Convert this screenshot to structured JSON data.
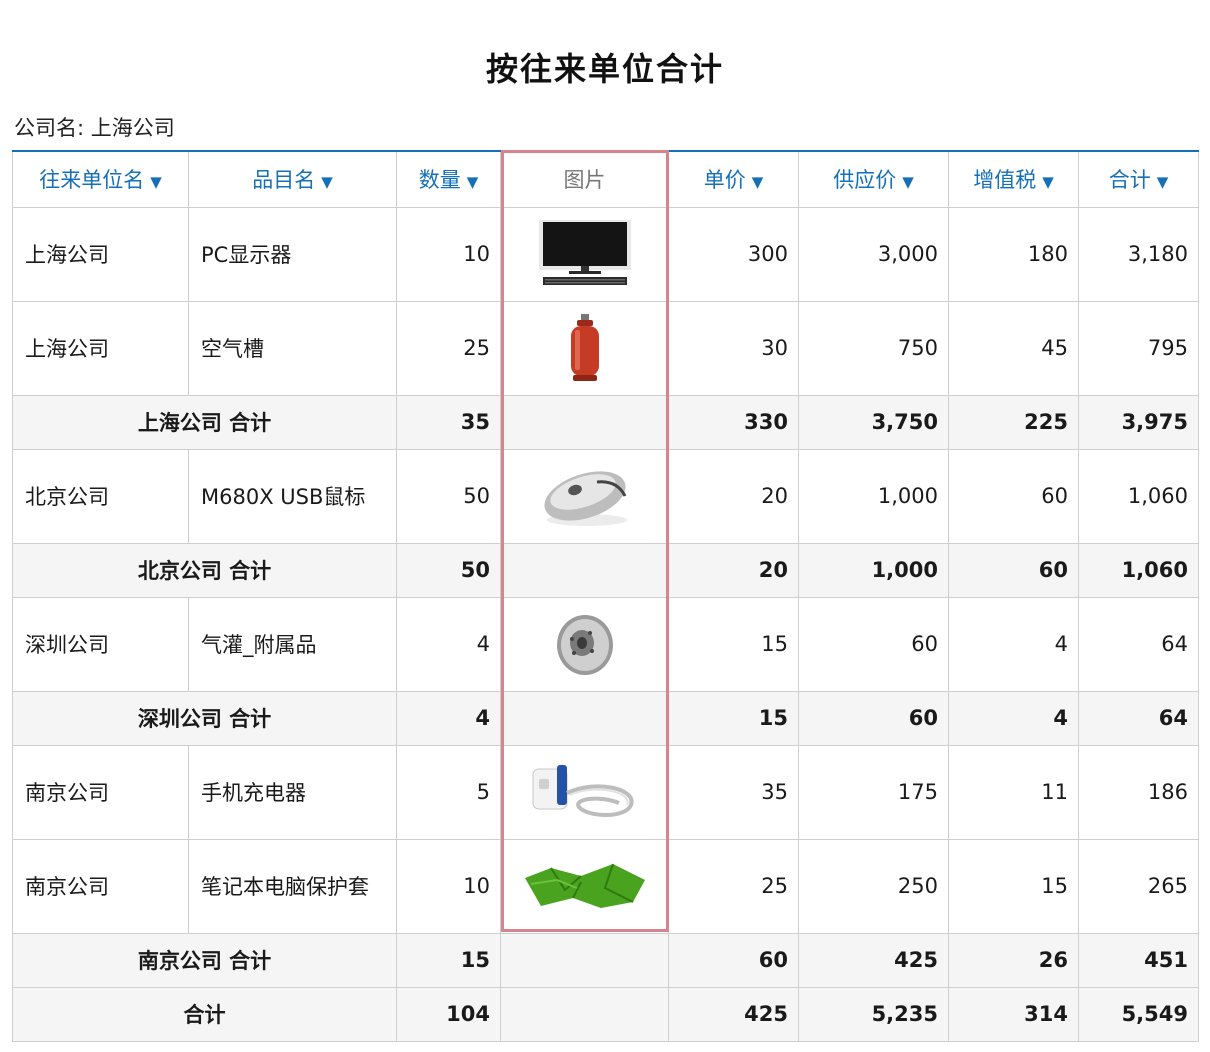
{
  "report": {
    "title": "按往来单位合计",
    "company_label": "公司名:",
    "company_value": "上海公司"
  },
  "columns": [
    {
      "key": "partner",
      "label": "往来单位名",
      "sortable": true
    },
    {
      "key": "item",
      "label": "品目名",
      "sortable": true
    },
    {
      "key": "qty",
      "label": "数量",
      "sortable": true
    },
    {
      "key": "image",
      "label": "图片",
      "sortable": false
    },
    {
      "key": "unit_price",
      "label": "单价",
      "sortable": true
    },
    {
      "key": "supply_price",
      "label": "供应价",
      "sortable": true
    },
    {
      "key": "vat",
      "label": "增值税",
      "sortable": true
    },
    {
      "key": "total",
      "label": "合计",
      "sortable": true
    }
  ],
  "rows": [
    {
      "type": "item",
      "partner": "上海公司",
      "item": "PC显示器",
      "qty": "10",
      "image_icon": "monitor-icon",
      "unit_price": "300",
      "supply_price": "3,000",
      "vat": "180",
      "total": "3,180"
    },
    {
      "type": "item",
      "partner": "上海公司",
      "item": "空气槽",
      "qty": "25",
      "image_icon": "gas-cylinder-icon",
      "unit_price": "30",
      "supply_price": "750",
      "vat": "45",
      "total": "795"
    },
    {
      "type": "subtotal",
      "label": "上海公司 合计",
      "qty": "35",
      "unit_price": "330",
      "supply_price": "3,750",
      "vat": "225",
      "total": "3,975"
    },
    {
      "type": "item",
      "partner": "北京公司",
      "item": "M680X USB鼠标",
      "qty": "50",
      "image_icon": "mouse-icon",
      "unit_price": "20",
      "supply_price": "1,000",
      "vat": "60",
      "total": "1,060"
    },
    {
      "type": "subtotal",
      "label": "北京公司 合计",
      "qty": "50",
      "unit_price": "20",
      "supply_price": "1,000",
      "vat": "60",
      "total": "1,060"
    },
    {
      "type": "item",
      "partner": "深圳公司",
      "item": "气灌_附属品",
      "qty": "4",
      "image_icon": "brake-disc-icon",
      "unit_price": "15",
      "supply_price": "60",
      "vat": "4",
      "total": "64"
    },
    {
      "type": "subtotal",
      "label": "深圳公司 合计",
      "qty": "4",
      "unit_price": "15",
      "supply_price": "60",
      "vat": "4",
      "total": "64"
    },
    {
      "type": "item",
      "partner": "南京公司",
      "item": "手机充电器",
      "qty": "5",
      "image_icon": "charger-icon",
      "unit_price": "35",
      "supply_price": "175",
      "vat": "11",
      "total": "186"
    },
    {
      "type": "item",
      "partner": "南京公司",
      "item": "笔记本电脑保护套",
      "qty": "10",
      "image_icon": "green-cloth-icon",
      "unit_price": "25",
      "supply_price": "250",
      "vat": "15",
      "total": "265"
    },
    {
      "type": "subtotal",
      "label": "南京公司 合计",
      "qty": "15",
      "unit_price": "60",
      "supply_price": "425",
      "vat": "26",
      "total": "451"
    },
    {
      "type": "grandtotal",
      "label": "合计",
      "qty": "104",
      "unit_price": "425",
      "supply_price": "5,235",
      "vat": "314",
      "total": "5,549"
    }
  ],
  "colors": {
    "header_text": "#1670b8",
    "subtotal_bg": "#f5f5f5",
    "highlight_border": "#d8838d",
    "grid": "#cfcfcf"
  }
}
